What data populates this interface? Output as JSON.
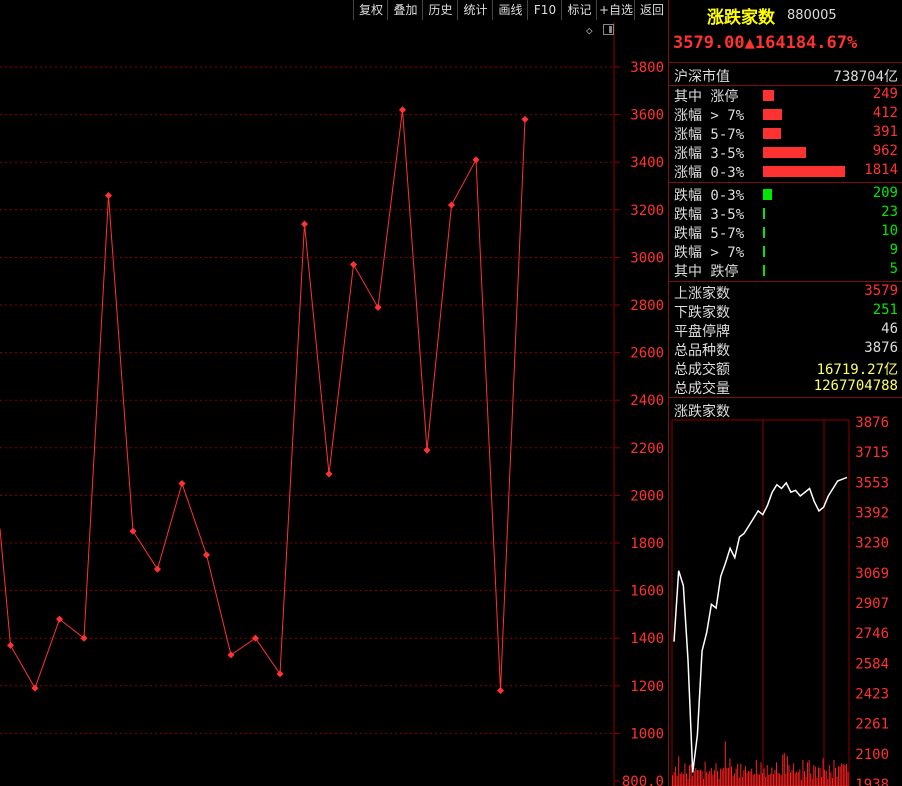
{
  "toolbar": {
    "buttons": [
      "复权",
      "叠加",
      "历史",
      "统计",
      "画线",
      "F10",
      "标记",
      "+自选",
      "返回"
    ]
  },
  "panel": {
    "title": "涨跌家数",
    "code": "880005",
    "price_line": "3579.00▲164184.67%",
    "market_cap_label": "沪深市值",
    "market_cap_value": "738704亿",
    "breakdown": [
      {
        "label": "其中 涨停",
        "value": "249",
        "color": "red",
        "fraction": 0.137
      },
      {
        "label": "涨幅 > 7%",
        "value": "412",
        "color": "red",
        "fraction": 0.227
      },
      {
        "label": "涨幅 5-7%",
        "value": "391",
        "color": "red",
        "fraction": 0.216
      },
      {
        "label": "涨幅 3-5%",
        "value": "962",
        "color": "red",
        "fraction": 0.53
      },
      {
        "label": "涨幅 0-3%",
        "value": "1814",
        "color": "red",
        "fraction": 1.0
      },
      {
        "label": "跌幅 0-3%",
        "value": "209",
        "color": "green",
        "fraction": 0.115
      },
      {
        "label": "跌幅 3-5%",
        "value": "23",
        "color": "green",
        "fraction": 0.013
      },
      {
        "label": "跌幅 5-7%",
        "value": "10",
        "color": "green",
        "fraction": 0.006
      },
      {
        "label": "跌幅 > 7%",
        "value": "9",
        "color": "green",
        "fraction": 0.005
      },
      {
        "label": "其中 跌停",
        "value": "5",
        "color": "green",
        "fraction": 0.003
      }
    ],
    "stats": [
      {
        "label": "上涨家数",
        "value": "3579",
        "color": "red"
      },
      {
        "label": "下跌家数",
        "value": "251",
        "color": "green"
      },
      {
        "label": "平盘停牌",
        "value": "46",
        "color": "white"
      },
      {
        "label": "总品种数",
        "value": "3876",
        "color": "white"
      },
      {
        "label": "总成交额",
        "value": "16719.27亿",
        "color": "yellow"
      },
      {
        "label": "总成交量",
        "value": "1267704788",
        "color": "yellow"
      }
    ]
  },
  "colors": {
    "line": "#ff3232",
    "grid": "#8b0000",
    "axis_text": "#ff3232",
    "mini_line": "#ffffff",
    "volume": "#ff2020"
  },
  "chart_data": [
    {
      "type": "line",
      "ylim": [
        800,
        3800
      ],
      "y_ticks": [
        "800.0",
        "1000",
        "1200",
        "1400",
        "1600",
        "1800",
        "2000",
        "2200",
        "2400",
        "2600",
        "2800",
        "3000",
        "3200",
        "3400",
        "3600",
        "3800"
      ],
      "grid": true,
      "x": [
        0,
        1,
        2,
        3,
        4,
        5,
        6,
        7,
        8,
        9,
        10,
        11,
        12,
        13,
        14,
        15,
        16,
        17,
        18,
        19,
        20,
        21
      ],
      "values": [
        1370,
        1190,
        1480,
        1400,
        3260,
        1850,
        1690,
        2050,
        1750,
        1330,
        1400,
        1250,
        3140,
        2090,
        2970,
        2790,
        3620,
        2190,
        3220,
        3410,
        1180,
        3580
      ]
    },
    {
      "type": "line",
      "title": "涨跌家数",
      "y_ticks": [
        "3876",
        "3715",
        "3553",
        "3392",
        "3230",
        "3069",
        "2907",
        "2746",
        "2584",
        "2423",
        "2261",
        "2100",
        "1938"
      ],
      "ylim": [
        1938,
        3876
      ],
      "grid": true,
      "series": [
        {
          "values": [
            2700,
            3080,
            3000,
            2600,
            2000,
            2200,
            2650,
            2750,
            2900,
            2880,
            3050,
            3120,
            3200,
            3150,
            3260,
            3280,
            3320,
            3360,
            3400,
            3380,
            3430,
            3500,
            3540,
            3520,
            3550,
            3500,
            3510,
            3480,
            3500,
            3520,
            3450,
            3400,
            3420,
            3480,
            3520,
            3560,
            3570,
            3579
          ]
        }
      ],
      "volume": [
        0.3,
        0.2,
        0.35,
        0.25,
        0.4,
        0.2,
        0.3,
        0.15,
        0.35,
        0.25,
        0.2,
        0.3,
        0.4,
        0.25,
        0.2,
        0.3,
        0.35,
        0.2,
        0.25,
        0.3,
        0.2,
        0.35,
        0.25,
        0.3,
        0.2,
        0.3,
        0.25,
        0.2,
        0.35,
        0.3,
        0.2,
        0.25,
        0.3,
        0.45,
        0.6,
        0.3,
        0.4,
        0.35
      ]
    }
  ]
}
